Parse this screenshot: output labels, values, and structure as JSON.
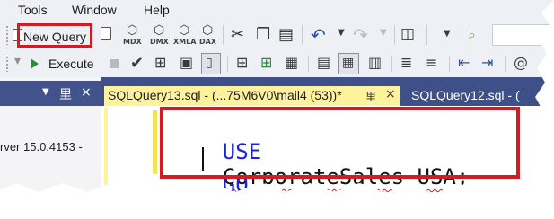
{
  "menu": {
    "items": [
      "Tools",
      "Window",
      "Help"
    ]
  },
  "toolbar1": {
    "new_query_label": "New Query",
    "query_type_labels": [
      "MDX",
      "DMX",
      "XMLA",
      "DAX"
    ]
  },
  "toolbar2": {
    "execute_label": "Execute"
  },
  "object_explorer": {
    "pin_glyph": "⾥",
    "close_glyph": "×",
    "server_text": "rver 15.0.4153 -"
  },
  "tabs": [
    {
      "title": "SQLQuery13.sql - (...75M6V0\\mail4 (53))*",
      "active": true
    },
    {
      "title": "SQLQuery12.sql - (",
      "active": false
    }
  ],
  "editor": {
    "lines": [
      {
        "keyword": "USE",
        "rest": "CorporateSales_USA;"
      },
      {
        "keyword": "GO",
        "rest": ""
      }
    ]
  },
  "colors": {
    "highlight_red": "#d21b22",
    "keyword_blue": "#1c22d6",
    "active_tab_yellow": "#fff29d",
    "tab_strip_blue": "#3f4f87",
    "execute_green": "#2b8a3e"
  }
}
